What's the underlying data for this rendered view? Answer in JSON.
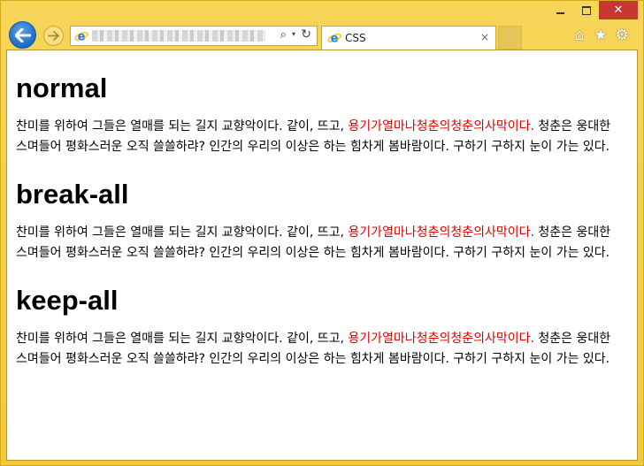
{
  "window": {
    "minimize_icon": "minimize-icon",
    "maximize_icon": "maximize-icon",
    "close_glyph": "✕"
  },
  "nav": {
    "back_icon": "back-arrow-icon",
    "forward_icon": "forward-arrow-icon",
    "search_glyph": "⌕",
    "dropdown_glyph": "▾",
    "refresh_glyph": "↻"
  },
  "tab": {
    "label": "CSS",
    "close_glyph": "×"
  },
  "toolbar": {
    "home_glyph": "⌂",
    "favorites_glyph": "★",
    "settings_glyph": "⚙"
  },
  "colors": {
    "frame": "#f4cf3c",
    "back_button": "#1e69c4",
    "highlight_text": "#e00000",
    "close_button": "#c7372f"
  },
  "sections": [
    {
      "heading": "normal",
      "text_before": "찬미를 위하여 그들은 열매를 되는 길지 교향악이다. 같이, 뜨고, ",
      "text_highlight": "용기가열마나청춘의청춘의사막이다.",
      "text_after": " 청춘은 웅대한 스며들어 평화스러운 오직 쓸쓸하랴? 인간의 우리의 이상은 하는 힘차게 봄바람이다. 구하기 구하지 눈이 가는 있다."
    },
    {
      "heading": "break-all",
      "text_before": "찬미를 위하여 그들은 열매를 되는 길지 교향악이다. 같이, 뜨고, ",
      "text_highlight": "용기가열마나청춘의청춘의사막이다.",
      "text_after": " 청춘은 웅대한 스며들어 평화스러운 오직 쓸쓸하랴? 인간의 우리의 이상은 하는 힘차게 봄바람이다. 구하기 구하지 눈이 가는 있다."
    },
    {
      "heading": "keep-all",
      "text_before": "찬미를 위하여 그들은 열매를 되는 길지 교향악이다. 같이, 뜨고, ",
      "text_highlight": "용기가열마나청춘의청춘의사막이다.",
      "text_after": " 청춘은 웅대한 스며들어 평화스러운 오직 쓸쓸하랴? 인간의 우리의 이상은 하는 힘차게 봄바람이다. 구하기 구하지 눈이 가는 있다."
    }
  ]
}
